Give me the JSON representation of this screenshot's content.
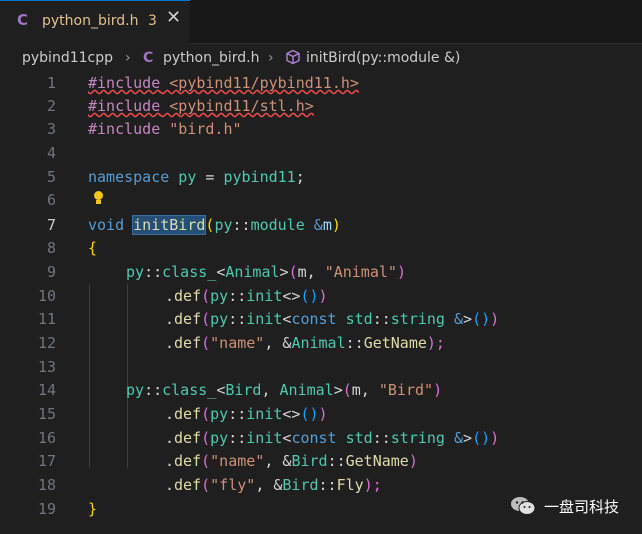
{
  "tab": {
    "lang_icon": "C",
    "title": "python_bird.h",
    "problem_count": "3",
    "close_glyph": "✕"
  },
  "breadcrumb": {
    "folder": "pybind11cpp",
    "sep": "›",
    "file_icon": "C",
    "file": "python_bird.h",
    "symbol_icon": "method-icon",
    "symbol": "initBird(py::module &)"
  },
  "editor": {
    "lines": [
      {
        "n": "1"
      },
      {
        "n": "2"
      },
      {
        "n": "3"
      },
      {
        "n": "4"
      },
      {
        "n": "5"
      },
      {
        "n": "6"
      },
      {
        "n": "7"
      },
      {
        "n": "8"
      },
      {
        "n": "9"
      },
      {
        "n": "10"
      },
      {
        "n": "11"
      },
      {
        "n": "12"
      },
      {
        "n": "13"
      },
      {
        "n": "14"
      },
      {
        "n": "15"
      },
      {
        "n": "16"
      },
      {
        "n": "17"
      },
      {
        "n": "18"
      },
      {
        "n": "19"
      }
    ],
    "active_line": "7",
    "code": {
      "l1a": "#include",
      "l1b": "<pybind11/pybind11.h>",
      "l2a": "#include",
      "l2b": "<pybind11/stl.h>",
      "l3a": "#include",
      "l3b": "\"bird.h\"",
      "l5a": "namespace",
      "l5b": " py ",
      "l5c": "=",
      "l5d": " pybind11",
      "l5e": ";",
      "l7a": "void",
      "l7b": "initBird",
      "l7c": "(",
      "l7d": "py",
      "l7e": "::",
      "l7f": "module",
      "l7g": " &",
      "l7h": "m",
      "l7i": ")",
      "l8": "{",
      "l9a": "py",
      "l9b": "::",
      "l9c": "class_",
      "l9d": "<",
      "l9e": "Animal",
      "l9f": ">",
      "l9g": "(",
      "l9h": "m, ",
      "l9i": "\"Animal\"",
      "l9j": ")",
      "l10a": ".",
      "l10b": "def",
      "l10c": "(",
      "l10d": "py",
      "l10e": "::",
      "l10f": "init",
      "l10g": "<>",
      "l10h": "()",
      "l10i": ")",
      "l11a": ".",
      "l11b": "def",
      "l11c": "(",
      "l11d": "py",
      "l11e": "::",
      "l11f": "init",
      "l11g": "<",
      "l11h": "const",
      "l11i": " std",
      "l11j": "::",
      "l11k": "string",
      "l11l": " &",
      "l11m": ">",
      "l11n": "()",
      "l11o": ")",
      "l12a": ".",
      "l12b": "def",
      "l12c": "(",
      "l12d": "\"name\"",
      "l12e": ", &",
      "l12f": "Animal",
      "l12g": "::",
      "l12h": "GetName",
      "l12i": ");",
      "l14a": "py",
      "l14b": "::",
      "l14c": "class_",
      "l14d": "<",
      "l14e": "Bird",
      "l14f": ", ",
      "l14g": "Animal",
      "l14h": ">",
      "l14i": "(",
      "l14j": "m, ",
      "l14k": "\"Bird\"",
      "l14l": ")",
      "l15a": ".",
      "l15b": "def",
      "l15c": "(",
      "l15d": "py",
      "l15e": "::",
      "l15f": "init",
      "l15g": "<>",
      "l15h": "()",
      "l15i": ")",
      "l16a": ".",
      "l16b": "def",
      "l16c": "(",
      "l16d": "py",
      "l16e": "::",
      "l16f": "init",
      "l16g": "<",
      "l16h": "const",
      "l16i": " std",
      "l16j": "::",
      "l16k": "string",
      "l16l": " &",
      "l16m": ">",
      "l16n": "()",
      "l16o": ")",
      "l17a": ".",
      "l17b": "def",
      "l17c": "(",
      "l17d": "\"name\"",
      "l17e": ", &",
      "l17f": "Bird",
      "l17g": "::",
      "l17h": "GetName",
      "l17i": ")",
      "l18a": ".",
      "l18b": "def",
      "l18c": "(",
      "l18d": "\"fly\"",
      "l18e": ", &",
      "l18f": "Bird",
      "l18g": "::",
      "l18h": "Fly",
      "l18i": ");",
      "l19": "}"
    },
    "lightbulb_icon": "lightbulb-icon"
  },
  "watermark": {
    "logo_icon": "wechat-icon",
    "text": "一盘司科技"
  },
  "colors": {
    "keyword": "#569cd6",
    "preprocessor": "#c586c0",
    "string": "#ce9178",
    "type": "#4ec9b0",
    "function": "#dcdcaa",
    "variable": "#9cdcfe",
    "bracket_gold": "#ffd700",
    "bracket_violet": "#da70d6",
    "bracket_blue": "#179fff",
    "tab_modified": "#e2c08d"
  }
}
